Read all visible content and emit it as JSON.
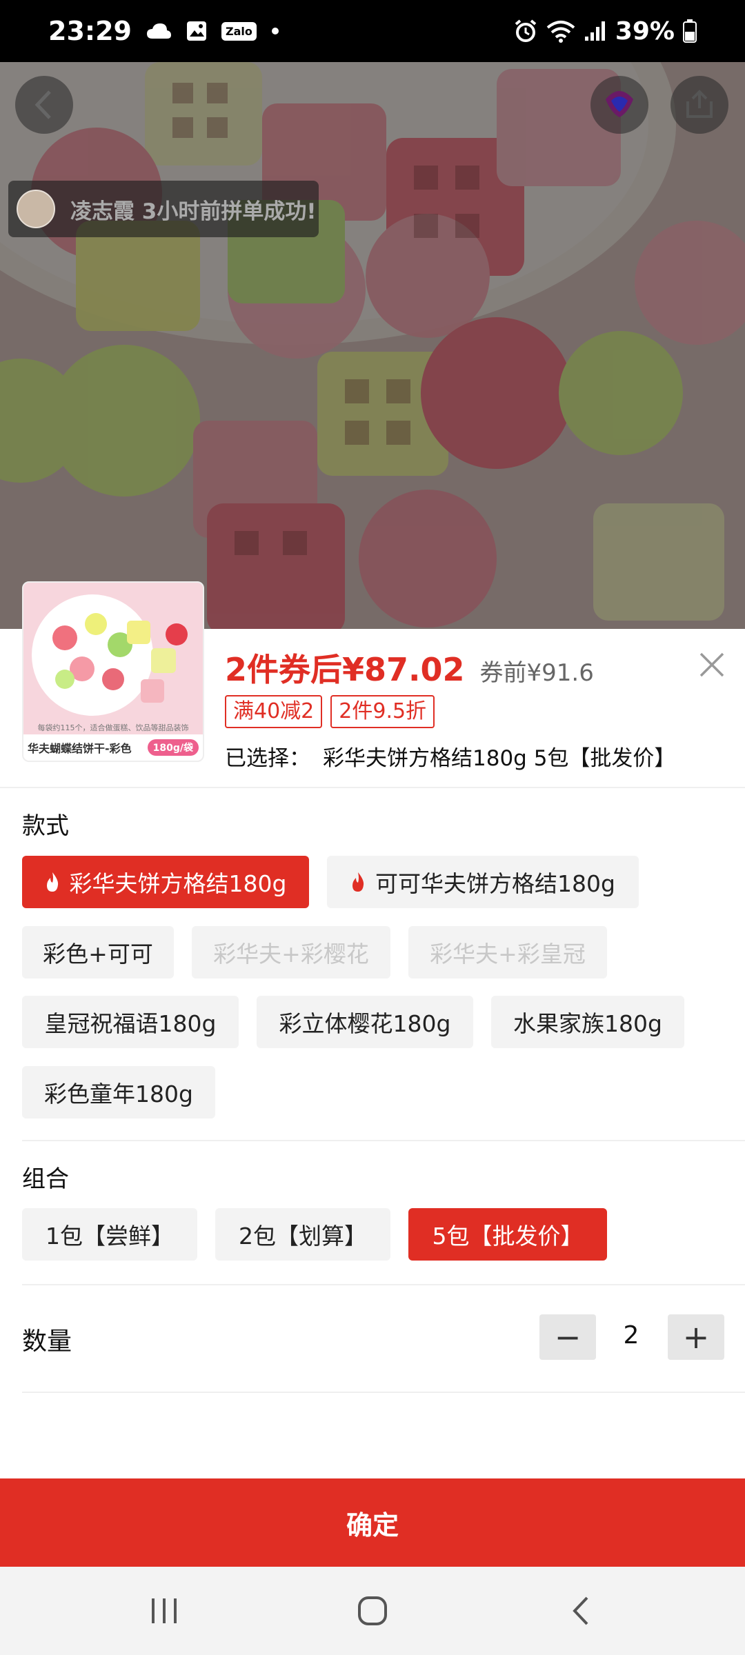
{
  "status_bar": {
    "time": "23:29",
    "zalo": "Zalo",
    "battery": "39%"
  },
  "hero": {
    "toast_text": "凌志霞 3小时前拼单成功!"
  },
  "product": {
    "thumb_caption": "华夫蝴蝶结饼干-彩色",
    "thumb_tag": "180g/袋",
    "thumb_note": "每袋约115个，适合做蛋糕、饮品等甜品装饰",
    "price_main": "2件券后¥87.02",
    "price_before": "券前¥91.6",
    "promos": [
      "满40减2",
      "2件9.5折"
    ],
    "selected_label": "已选择：",
    "selected_value": "彩华夫饼方格结180g 5包【批发价】"
  },
  "style_section": {
    "title": "款式",
    "options": [
      {
        "label": "彩华夫饼方格结180g",
        "hot": true,
        "state": "active"
      },
      {
        "label": "可可华夫饼方格结180g",
        "hot": true,
        "state": "normal"
      },
      {
        "label": "彩色+可可",
        "hot": false,
        "state": "normal"
      },
      {
        "label": "彩华夫+彩樱花",
        "hot": false,
        "state": "disabled"
      },
      {
        "label": "彩华夫+彩皇冠",
        "hot": false,
        "state": "disabled"
      },
      {
        "label": "皇冠祝福语180g",
        "hot": false,
        "state": "normal"
      },
      {
        "label": "彩立体樱花180g",
        "hot": false,
        "state": "normal"
      },
      {
        "label": "水果家族180g",
        "hot": false,
        "state": "normal"
      },
      {
        "label": "彩色童年180g",
        "hot": false,
        "state": "normal"
      }
    ]
  },
  "combo_section": {
    "title": "组合",
    "options": [
      {
        "label": "1包【尝鲜】",
        "state": "normal"
      },
      {
        "label": "2包【划算】",
        "state": "normal"
      },
      {
        "label": "5包【批发价】",
        "state": "active"
      }
    ]
  },
  "quantity": {
    "label": "数量",
    "minus": "−",
    "value": "2",
    "plus": "+"
  },
  "confirm_label": "确定",
  "colors": {
    "accent": "#e02e24",
    "chip_bg": "#f3f3f3"
  }
}
